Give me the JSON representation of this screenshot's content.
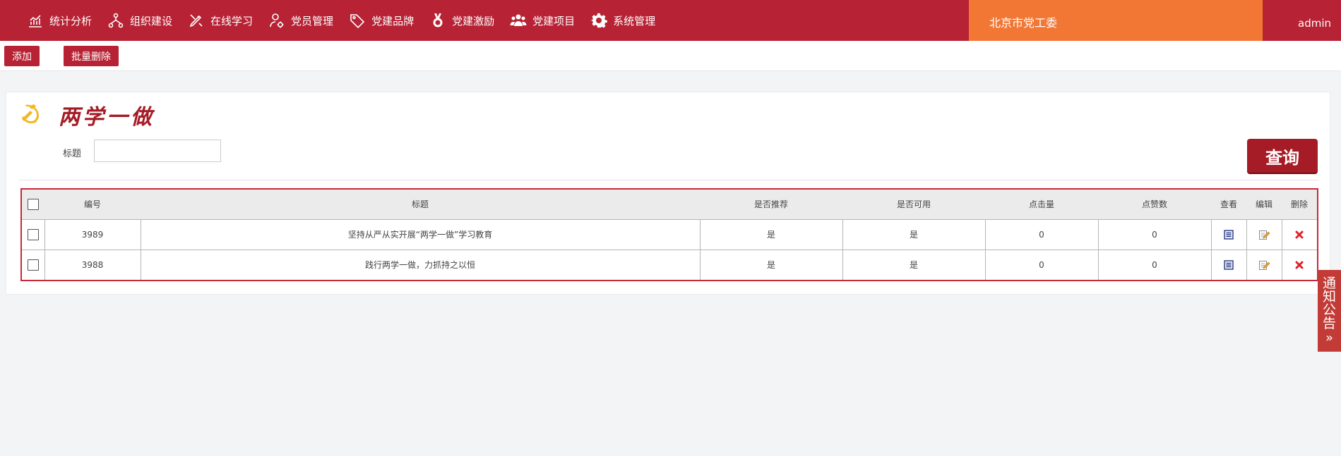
{
  "nav": {
    "items": [
      {
        "label": "统计分析",
        "icon": "chart-icon"
      },
      {
        "label": "组织建设",
        "icon": "org-tree-icon"
      },
      {
        "label": "在线学习",
        "icon": "pencil-icon"
      },
      {
        "label": "党员管理",
        "icon": "user-gear-icon"
      },
      {
        "label": "党建品牌",
        "icon": "tag-icon"
      },
      {
        "label": "党建激励",
        "icon": "medal-icon"
      },
      {
        "label": "党建项目",
        "icon": "group-icon"
      },
      {
        "label": "系统管理",
        "icon": "gear-icon"
      }
    ],
    "org_name": "北京市党工委",
    "user": "admin"
  },
  "toolbar": {
    "add_label": "添加",
    "batch_delete_label": "批量删除"
  },
  "page": {
    "title": "两学一做",
    "emblem": "party-emblem-icon"
  },
  "filter": {
    "title_label": "标题",
    "title_value": "",
    "query_label": "查询"
  },
  "table": {
    "headers": {
      "id": "编号",
      "title": "标题",
      "recommended": "是否推荐",
      "available": "是否可用",
      "clicks": "点击量",
      "likes": "点赞数",
      "view": "查看",
      "edit": "编辑",
      "delete": "删除"
    },
    "rows": [
      {
        "id": "3989",
        "title": "坚持从严从实开展“两学一做”学习教育",
        "recommended": "是",
        "available": "是",
        "clicks": "0",
        "likes": "0"
      },
      {
        "id": "3988",
        "title": "践行两学一做，力抓持之以恒",
        "recommended": "是",
        "available": "是",
        "clicks": "0",
        "likes": "0"
      }
    ]
  },
  "side_tab": {
    "chars": [
      "通",
      "知",
      "公",
      "告"
    ],
    "arrow": "»"
  },
  "colors": {
    "brand_red": "#b72234",
    "org_orange": "#f27735",
    "title_red": "#a51b26",
    "table_border": "#c8283a"
  }
}
